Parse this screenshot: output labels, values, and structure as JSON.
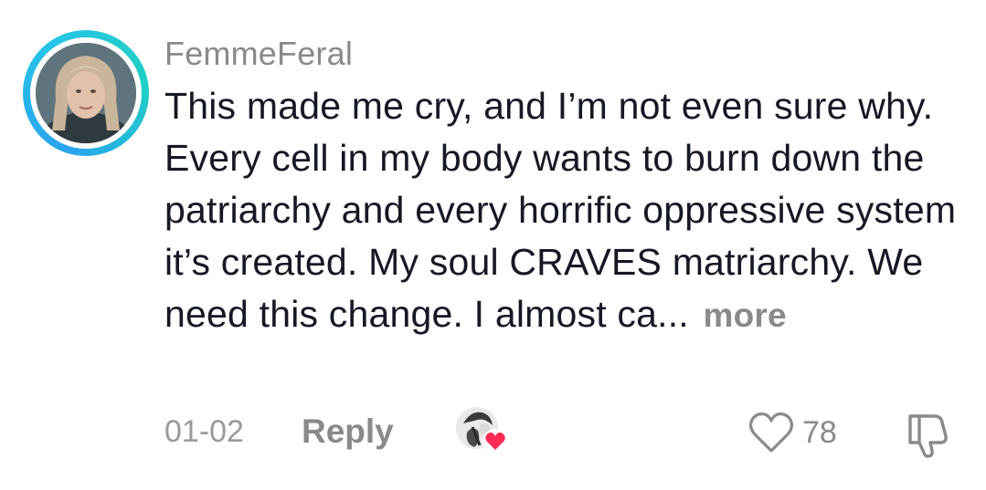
{
  "comment": {
    "username": "FemmeFeral",
    "text": "This made me cry, and I’m not even sure why. Every cell in my body wants to burn down the patriarchy and every horrific oppressive system it’s created. My soul CRAVES matriarchy. We need this change. I almost ca...",
    "more_label": "more",
    "date": "01-02",
    "reply_label": "Reply",
    "like_count": "78",
    "liked_by_creator": true,
    "icons": {
      "avatar_ring_color": "#2aa3ee",
      "like": "heart-outline-icon",
      "dislike": "thumbs-down-icon",
      "creator_badge": "red-heart-icon"
    },
    "colors": {
      "text": "#161823",
      "muted": "#8a8a8a",
      "creator_heart": "#fe2c55"
    }
  }
}
